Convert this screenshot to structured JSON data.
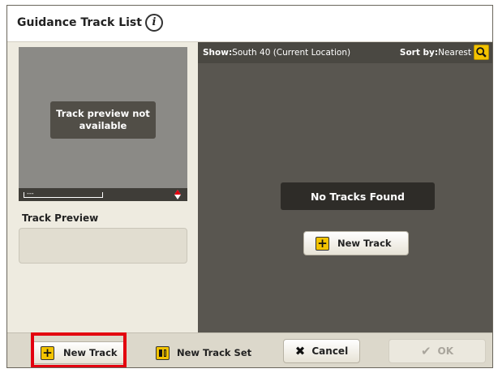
{
  "header": {
    "title": "Guidance Track List",
    "info_icon": "i"
  },
  "left_panel": {
    "preview_message": "Track preview not available",
    "scale_text": "---",
    "track_preview_label": "Track Preview"
  },
  "right_panel": {
    "show_label": "Show:",
    "show_value": "South 40 (Current Location)",
    "sort_label": "Sort by:",
    "sort_value": "Nearest",
    "no_tracks_message": "No Tracks Found",
    "new_track_button": "New Track"
  },
  "bottom_bar": {
    "new_track": "New Track",
    "new_track_set": "New Track Set",
    "cancel": "Cancel",
    "ok": "OK"
  },
  "colors": {
    "accent_yellow": "#f3c300",
    "highlight_red": "#e3000f",
    "panel_dark": "#595650"
  }
}
